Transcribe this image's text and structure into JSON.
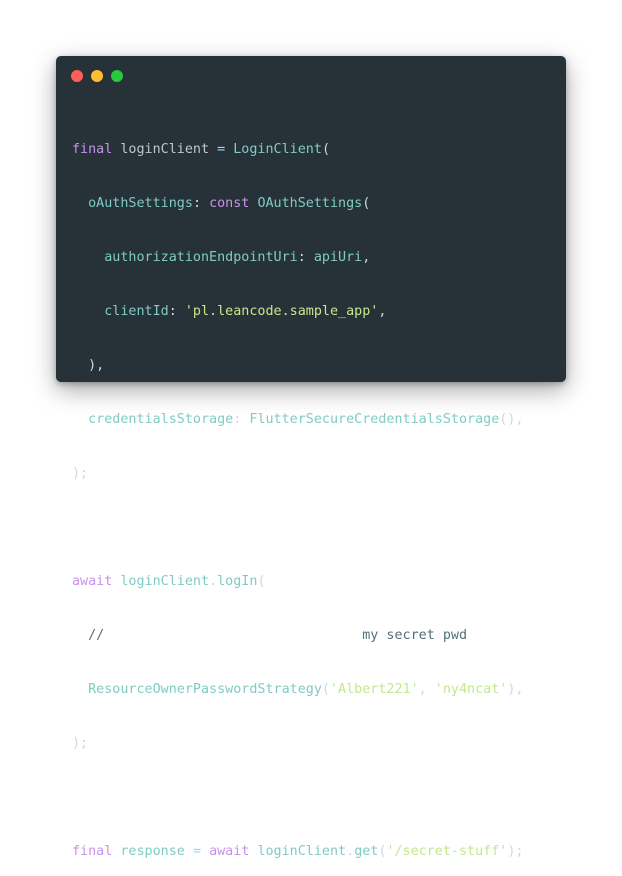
{
  "window": {
    "controls": {
      "close_color": "#ff5f56",
      "minimize_color": "#ffbd2e",
      "maximize_color": "#27c93f"
    }
  },
  "code": {
    "language": "dart",
    "lines": [
      "final loginClient = LoginClient(",
      "  oAuthSettings: const OAuthSettings(",
      "    authorizationEndpointUri: apiUri,",
      "    clientId: 'pl.leancode.sample_app',",
      "  ),",
      "  credentialsStorage: FlutterSecureCredentialsStorage(),",
      ");",
      "",
      "await loginClient.logIn(",
      "  //                                my secret pwd",
      "  ResourceOwnerPasswordStrategy('Albert221', 'ny4ncat'),",
      ");",
      "",
      "final response = await loginClient.get('/secret-stuff');"
    ],
    "tokens": {
      "l1_final": "final",
      "l1_var": "loginClient",
      "l1_eq": "=",
      "l1_cls": "LoginClient",
      "l1_paren": "(",
      "l2_prop": "oAuthSettings",
      "l2_colon": ":",
      "l2_const": "const",
      "l2_cls": "OAuthSettings",
      "l2_paren": "(",
      "l3_prop": "authorizationEndpointUri",
      "l3_colon": ":",
      "l3_val": "apiUri",
      "l3_comma": ",",
      "l4_prop": "clientId",
      "l4_colon": ":",
      "l4_str": "'pl.leancode.sample_app'",
      "l4_comma": ",",
      "l5": "),",
      "l6_prop": "credentialsStorage",
      "l6_colon": ":",
      "l6_cls": "FlutterSecureCredentialsStorage",
      "l6_parens": "(),",
      "l7": ");",
      "l9_await": "await",
      "l9_var": "loginClient",
      "l9_dot": ".",
      "l9_fn": "logIn",
      "l9_paren": "(",
      "l10_comment": "//                                my secret pwd",
      "l11_cls": "ResourceOwnerPasswordStrategy",
      "l11_open": "(",
      "l11_str1": "'Albert221'",
      "l11_comma": ", ",
      "l11_str2": "'ny4ncat'",
      "l11_close": "),",
      "l12": ");",
      "l14_final": "final",
      "l14_var": "response",
      "l14_eq": "=",
      "l14_await": "await",
      "l14_obj": "loginClient",
      "l14_dot": ".",
      "l14_fn": "get",
      "l14_open": "(",
      "l14_str": "'/secret-stuff'",
      "l14_close": ");"
    }
  },
  "colors": {
    "background": "#263238",
    "keyword": "#c792ea",
    "function": "#82aaff",
    "class": "#ffcb6b",
    "string": "#c3e88d",
    "comment": "#546e7a"
  }
}
